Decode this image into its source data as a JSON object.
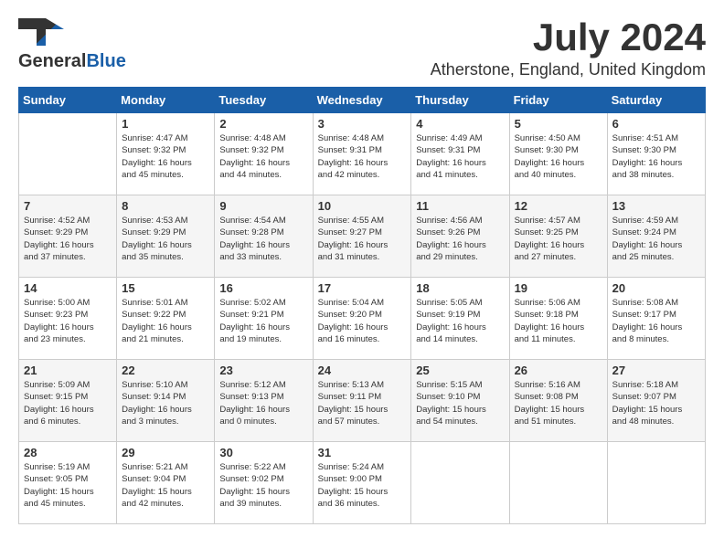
{
  "logo": {
    "general": "General",
    "blue": "Blue"
  },
  "title": "July 2024",
  "location": "Atherstone, England, United Kingdom",
  "weekdays": [
    "Sunday",
    "Monday",
    "Tuesday",
    "Wednesday",
    "Thursday",
    "Friday",
    "Saturday"
  ],
  "weeks": [
    [
      {
        "day": "",
        "info": ""
      },
      {
        "day": "1",
        "info": "Sunrise: 4:47 AM\nSunset: 9:32 PM\nDaylight: 16 hours\nand 45 minutes."
      },
      {
        "day": "2",
        "info": "Sunrise: 4:48 AM\nSunset: 9:32 PM\nDaylight: 16 hours\nand 44 minutes."
      },
      {
        "day": "3",
        "info": "Sunrise: 4:48 AM\nSunset: 9:31 PM\nDaylight: 16 hours\nand 42 minutes."
      },
      {
        "day": "4",
        "info": "Sunrise: 4:49 AM\nSunset: 9:31 PM\nDaylight: 16 hours\nand 41 minutes."
      },
      {
        "day": "5",
        "info": "Sunrise: 4:50 AM\nSunset: 9:30 PM\nDaylight: 16 hours\nand 40 minutes."
      },
      {
        "day": "6",
        "info": "Sunrise: 4:51 AM\nSunset: 9:30 PM\nDaylight: 16 hours\nand 38 minutes."
      }
    ],
    [
      {
        "day": "7",
        "info": "Sunrise: 4:52 AM\nSunset: 9:29 PM\nDaylight: 16 hours\nand 37 minutes."
      },
      {
        "day": "8",
        "info": "Sunrise: 4:53 AM\nSunset: 9:29 PM\nDaylight: 16 hours\nand 35 minutes."
      },
      {
        "day": "9",
        "info": "Sunrise: 4:54 AM\nSunset: 9:28 PM\nDaylight: 16 hours\nand 33 minutes."
      },
      {
        "day": "10",
        "info": "Sunrise: 4:55 AM\nSunset: 9:27 PM\nDaylight: 16 hours\nand 31 minutes."
      },
      {
        "day": "11",
        "info": "Sunrise: 4:56 AM\nSunset: 9:26 PM\nDaylight: 16 hours\nand 29 minutes."
      },
      {
        "day": "12",
        "info": "Sunrise: 4:57 AM\nSunset: 9:25 PM\nDaylight: 16 hours\nand 27 minutes."
      },
      {
        "day": "13",
        "info": "Sunrise: 4:59 AM\nSunset: 9:24 PM\nDaylight: 16 hours\nand 25 minutes."
      }
    ],
    [
      {
        "day": "14",
        "info": "Sunrise: 5:00 AM\nSunset: 9:23 PM\nDaylight: 16 hours\nand 23 minutes."
      },
      {
        "day": "15",
        "info": "Sunrise: 5:01 AM\nSunset: 9:22 PM\nDaylight: 16 hours\nand 21 minutes."
      },
      {
        "day": "16",
        "info": "Sunrise: 5:02 AM\nSunset: 9:21 PM\nDaylight: 16 hours\nand 19 minutes."
      },
      {
        "day": "17",
        "info": "Sunrise: 5:04 AM\nSunset: 9:20 PM\nDaylight: 16 hours\nand 16 minutes."
      },
      {
        "day": "18",
        "info": "Sunrise: 5:05 AM\nSunset: 9:19 PM\nDaylight: 16 hours\nand 14 minutes."
      },
      {
        "day": "19",
        "info": "Sunrise: 5:06 AM\nSunset: 9:18 PM\nDaylight: 16 hours\nand 11 minutes."
      },
      {
        "day": "20",
        "info": "Sunrise: 5:08 AM\nSunset: 9:17 PM\nDaylight: 16 hours\nand 8 minutes."
      }
    ],
    [
      {
        "day": "21",
        "info": "Sunrise: 5:09 AM\nSunset: 9:15 PM\nDaylight: 16 hours\nand 6 minutes."
      },
      {
        "day": "22",
        "info": "Sunrise: 5:10 AM\nSunset: 9:14 PM\nDaylight: 16 hours\nand 3 minutes."
      },
      {
        "day": "23",
        "info": "Sunrise: 5:12 AM\nSunset: 9:13 PM\nDaylight: 16 hours\nand 0 minutes."
      },
      {
        "day": "24",
        "info": "Sunrise: 5:13 AM\nSunset: 9:11 PM\nDaylight: 15 hours\nand 57 minutes."
      },
      {
        "day": "25",
        "info": "Sunrise: 5:15 AM\nSunset: 9:10 PM\nDaylight: 15 hours\nand 54 minutes."
      },
      {
        "day": "26",
        "info": "Sunrise: 5:16 AM\nSunset: 9:08 PM\nDaylight: 15 hours\nand 51 minutes."
      },
      {
        "day": "27",
        "info": "Sunrise: 5:18 AM\nSunset: 9:07 PM\nDaylight: 15 hours\nand 48 minutes."
      }
    ],
    [
      {
        "day": "28",
        "info": "Sunrise: 5:19 AM\nSunset: 9:05 PM\nDaylight: 15 hours\nand 45 minutes."
      },
      {
        "day": "29",
        "info": "Sunrise: 5:21 AM\nSunset: 9:04 PM\nDaylight: 15 hours\nand 42 minutes."
      },
      {
        "day": "30",
        "info": "Sunrise: 5:22 AM\nSunset: 9:02 PM\nDaylight: 15 hours\nand 39 minutes."
      },
      {
        "day": "31",
        "info": "Sunrise: 5:24 AM\nSunset: 9:00 PM\nDaylight: 15 hours\nand 36 minutes."
      },
      {
        "day": "",
        "info": ""
      },
      {
        "day": "",
        "info": ""
      },
      {
        "day": "",
        "info": ""
      }
    ]
  ]
}
